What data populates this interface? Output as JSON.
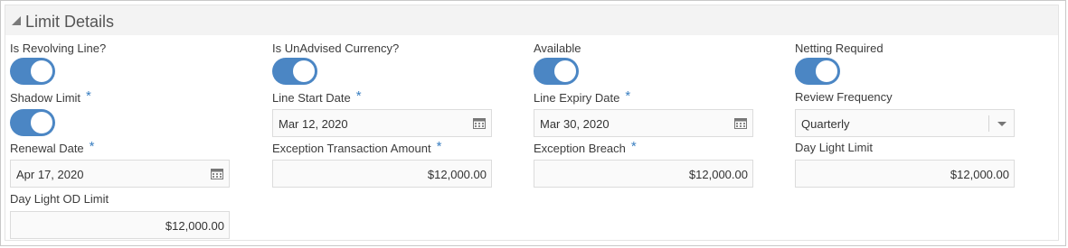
{
  "section": {
    "title": "Limit Details"
  },
  "fields": {
    "revolving": {
      "label": "Is Revolving Line?",
      "value": true
    },
    "unadvised": {
      "label": "Is UnAdvised Currency?",
      "value": true
    },
    "available": {
      "label": "Available",
      "value": true
    },
    "netting": {
      "label": "Netting Required",
      "value": true
    },
    "shadow": {
      "label": "Shadow Limit",
      "value": true,
      "required": "*"
    },
    "line_start": {
      "label": "Line Start Date",
      "value": "Mar 12, 2020",
      "required": "*"
    },
    "line_expiry": {
      "label": "Line Expiry Date",
      "value": "Mar 30, 2020",
      "required": "*"
    },
    "review_freq": {
      "label": "Review Frequency",
      "value": "Quarterly"
    },
    "renewal": {
      "label": "Renewal Date",
      "value": "Apr 17, 2020",
      "required": "*"
    },
    "exc_amount": {
      "label": "Exception Transaction Amount",
      "value": "$12,000.00",
      "required": "*"
    },
    "exc_breach": {
      "label": "Exception Breach",
      "value": "$12,000.00",
      "required": "*"
    },
    "daylight": {
      "label": "Day Light Limit",
      "value": "$12,000.00"
    },
    "daylight_od": {
      "label": "Day Light OD Limit",
      "value": "$12,000.00"
    }
  },
  "icons": {
    "collapse": "collapse-triangle-icon",
    "calendar": "calendar-icon",
    "dropdown": "chevron-down-icon"
  },
  "colors": {
    "toggle_on": "#4b86c4",
    "required": "#3a7fc1"
  }
}
